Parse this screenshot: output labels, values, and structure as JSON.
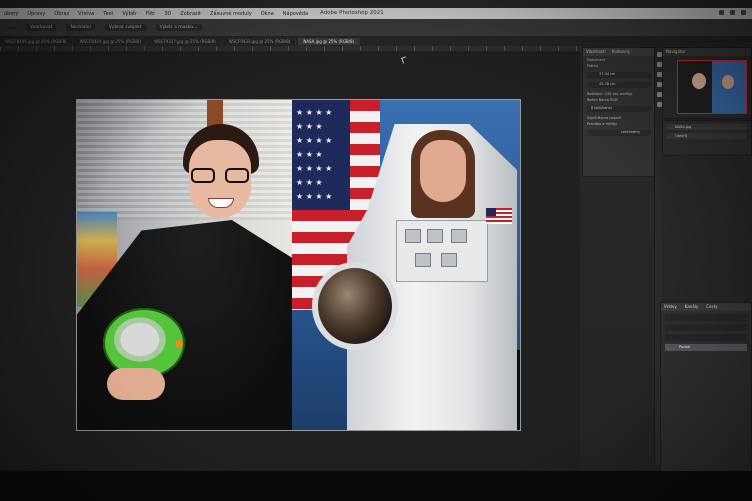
{
  "app": {
    "window_title": "Adobe Photoshop 2021",
    "menu": [
      "úbory",
      "Úpravy",
      "Obraz",
      "Vrstva",
      "Text",
      "Výběr",
      "Filtr",
      "3D",
      "Zobrazit",
      "Zásuvné moduly",
      "Okna",
      "Nápověda"
    ]
  },
  "options_bar": {
    "items": [
      "",
      "Vzorkovat",
      "Normální",
      "Vybrat subjekt",
      "Výběr a maska…"
    ]
  },
  "tabs": [
    "WSCF8449.jpg @ 25% (RGB/8)",
    "WSCF8424.jpg @ 25% (RGB/8)",
    "WSCF9337.jpg @ 25% (RGB/8)",
    "WSCF9433.jpg @ 25% (RGB/8)",
    "NASA.jpg @ 25% (RGB/8)"
  ],
  "active_tab_index": 4,
  "properties_panel": {
    "tabs": [
      "Vlastnosti",
      "Knihovny"
    ],
    "section_doc": "Dokument",
    "section_canvas": "Plátno",
    "width": "37,04 cm",
    "height": "45,38 cm",
    "resolution_label": "Rozlišení: 240 obr. bodů/p.",
    "mode_label": "Režim",
    "mode_value": "Barva RGB",
    "depth_value": "8 bitů/kanál",
    "fill_label": "Výplň",
    "fill_value": "Barva pozadí",
    "guides_label": "Pravítka a mřížky",
    "units_value": "centimetry"
  },
  "navigator": {
    "tabs": [
      "Navigátor"
    ]
  },
  "layers_top": {
    "tabs": [
      "Historie",
      "Akce"
    ],
    "rows": [
      "NASA.jpg",
      "Otevřít"
    ]
  },
  "layers_panel": {
    "tabs": [
      "Vrstvy",
      "Kanály",
      "Cesty"
    ],
    "selected_layer": "Pozadí"
  },
  "icons": {
    "cursor": "arrow-cursor-icon",
    "window_controls": [
      "minimize-icon",
      "maximize-icon",
      "close-icon"
    ]
  }
}
